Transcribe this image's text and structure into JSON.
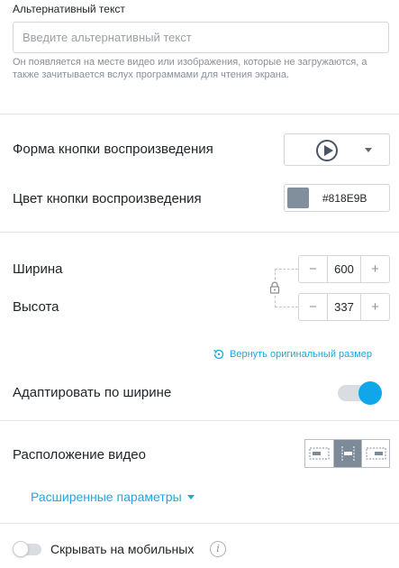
{
  "alt_text": {
    "label": "Альтернативный текст",
    "placeholder": "Введите альтернативный текст",
    "hint": "Он появляется на месте видео или изображения, которые не загружаются, а также зачитывается вслух программами для чтения экрана."
  },
  "play_button": {
    "shape_label": "Форма кнопки воспроизведения",
    "shape_icon": "play-circle-icon",
    "color_label": "Цвет кнопки воспроизведения",
    "color_value": "#818E9B"
  },
  "size": {
    "width_label": "Ширина",
    "width_value": "600",
    "height_label": "Высота",
    "height_value": "337",
    "minus": "−",
    "plus": "+",
    "lock_icon": "lock-icon",
    "reset_label": "Вернуть оригинальный размер"
  },
  "fit_width": {
    "label": "Адаптировать по ширине",
    "enabled": true
  },
  "video_align": {
    "label": "Расположение видео",
    "options": [
      "align-left",
      "align-center",
      "align-right"
    ],
    "selected": "align-center"
  },
  "advanced": {
    "label": "Расширенные параметры"
  },
  "hide_mobile": {
    "label": "Скрывать на мобильных",
    "enabled": false,
    "info_glyph": "i"
  },
  "colors": {
    "accent": "#1EA7E1",
    "toggle_on": "#10A6EA",
    "active_segment": "#7D8B99"
  }
}
